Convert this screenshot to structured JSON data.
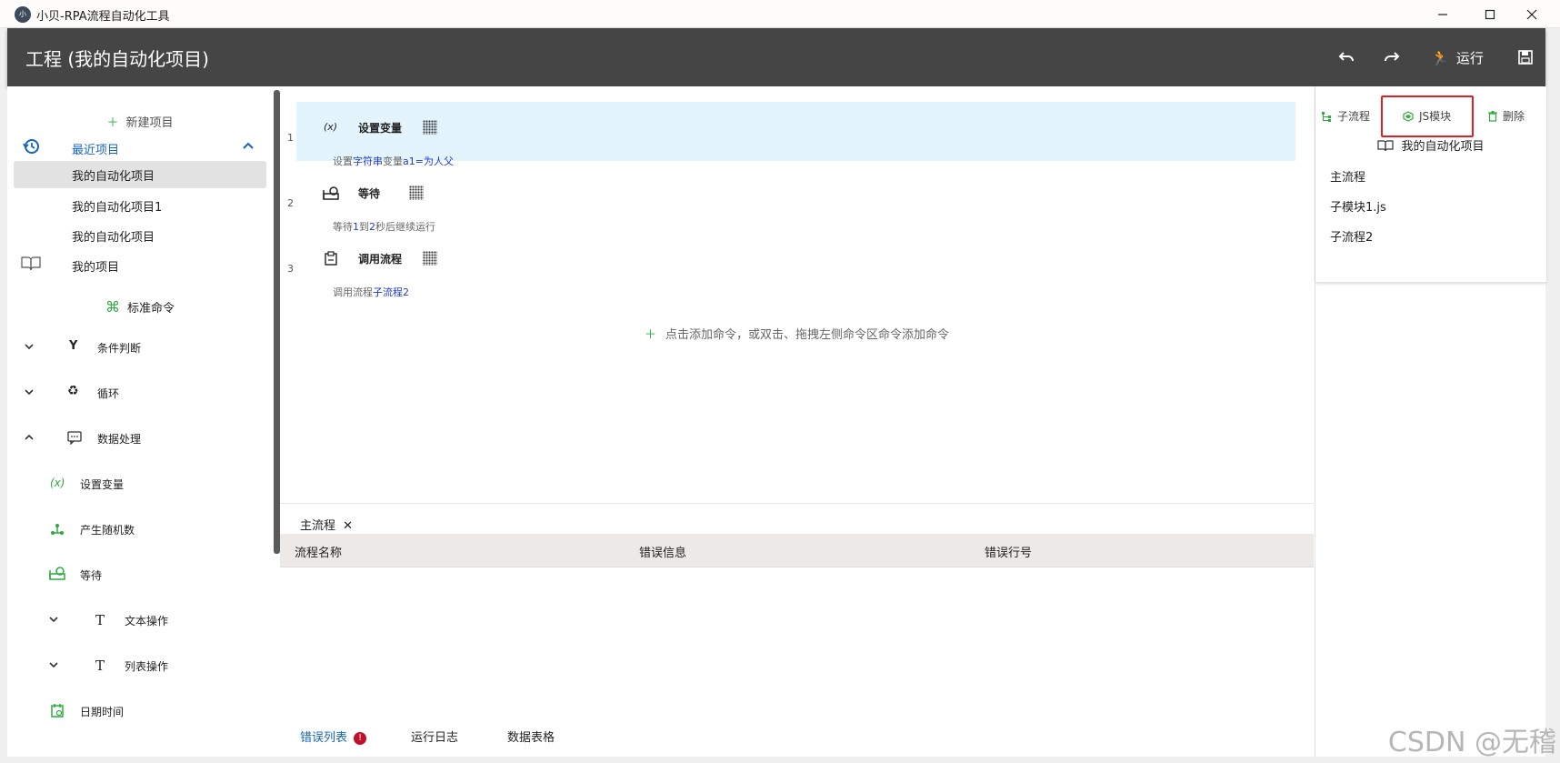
{
  "window": {
    "title": "小贝-RPA流程自动化工具",
    "minimize": "—",
    "maximize": "☐",
    "close": "✕"
  },
  "header": {
    "project_title": "工程 (我的自动化项目)",
    "undo": "↶",
    "redo": "↷",
    "run_label": "运行",
    "save": "💾"
  },
  "sidebar": {
    "new_project": "新建项目",
    "recent_projects": "最近项目",
    "recent_items": [
      "我的自动化项目",
      "我的自动化项目1",
      "我的自动化项目"
    ],
    "my_projects": "我的项目",
    "standard_commands": "标准命令",
    "categories": [
      {
        "label": "条件判断",
        "expanded": false
      },
      {
        "label": "循环",
        "expanded": false
      },
      {
        "label": "数据处理",
        "expanded": true
      }
    ],
    "data_items": [
      {
        "label": "设置变量",
        "icon": "(x)"
      },
      {
        "label": "产生随机数",
        "icon": "random-icon"
      },
      {
        "label": "等待",
        "icon": "wait-icon"
      }
    ],
    "sub_categories": [
      "文本操作",
      "列表操作"
    ],
    "date_item": "日期时间"
  },
  "editor": {
    "lines": [
      {
        "num": "1",
        "icon": "(x)",
        "title": "设置变量",
        "desc_parts": [
          "设置",
          "字符串",
          "变量",
          "a1=为人父"
        ]
      },
      {
        "num": "2",
        "icon": "wait-icon",
        "title": "等待",
        "desc_parts": [
          "等待",
          "1",
          "到",
          "2",
          "秒后继续运行"
        ]
      },
      {
        "num": "3",
        "icon": "clipboard-icon",
        "title": "调用流程",
        "desc_parts": [
          "调用流程",
          "子流程2"
        ]
      }
    ],
    "add_hint": "点击添加命令，或双击、拖拽左侧命令区命令添加命令"
  },
  "bottom": {
    "tab_name": "主流程",
    "columns": [
      "流程名称",
      "错误信息",
      "错误行号"
    ],
    "tabs": [
      "错误列表",
      "运行日志",
      "数据表格"
    ]
  },
  "right_panel": {
    "subflow_tab": "子流程",
    "js_tab": "JS模块",
    "delete_tab": "删除",
    "project_name": "我的自动化项目",
    "items": [
      "主流程",
      "子模块1.js",
      "子流程2"
    ]
  },
  "watermark": "CSDN @无稽",
  "colors": {
    "accent": "#1565c0",
    "header": "#454545",
    "highlight": "#e3f4fc",
    "green": "#2eaa3f",
    "red": "#e02020"
  }
}
